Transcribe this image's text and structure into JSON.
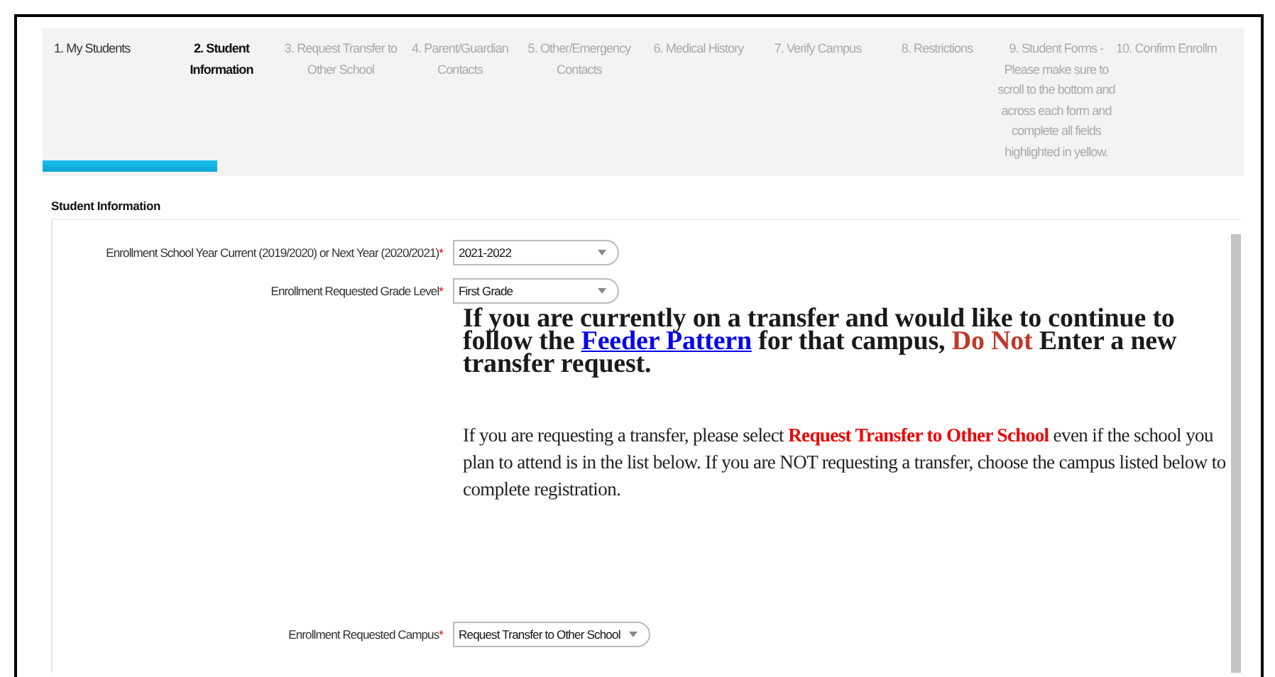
{
  "steps": [
    {
      "label": "1. My Students",
      "selected": false,
      "disabled": false
    },
    {
      "label": "2. Student Information",
      "selected": true,
      "disabled": false
    },
    {
      "label": "3. Request Transfer to Other School",
      "selected": false,
      "disabled": true
    },
    {
      "label": "4. Parent/Guardian Contacts",
      "selected": false,
      "disabled": true
    },
    {
      "label": "5. Other/Emergency Contacts",
      "selected": false,
      "disabled": true
    },
    {
      "label": "6. Medical History",
      "selected": false,
      "disabled": true
    },
    {
      "label": "7. Verify Campus",
      "selected": false,
      "disabled": true
    },
    {
      "label": "8. Restrictions",
      "selected": false,
      "disabled": true
    },
    {
      "label": "9. Student Forms - Please make sure to scroll to the bottom and across each form and complete all fields highlighted in yellow.",
      "selected": false,
      "disabled": true
    },
    {
      "label": "10. Confirm Enrollm",
      "selected": false,
      "disabled": true
    }
  ],
  "progress": {
    "level": 0.145
  },
  "section_title": "Student Information",
  "fields": [
    {
      "label": "Enrollment School Year Current (2019/2020) or Next Year (2020/2021)",
      "required_mark": "*",
      "value": "2021-2022"
    },
    {
      "label": "Enrollment Requested Grade Level",
      "required_mark": "*",
      "value": "First Grade"
    }
  ],
  "notice": [
    {
      "kind": "plain",
      "text": "If you are currently on a transfer and would like to continue to follow the "
    },
    {
      "kind": "link",
      "text": "Feeder Pattern"
    },
    {
      "kind": "plain",
      "text": " for that campus, "
    },
    {
      "kind": "warning",
      "text": "Do Not"
    },
    {
      "kind": "plain",
      "text": " Enter a new transfer request."
    }
  ],
  "instructions": [
    {
      "kind": "plain",
      "text": "If you are requesting a transfer, please select "
    },
    {
      "kind": "warning",
      "text": "Request Transfer to Other School"
    },
    {
      "kind": "plain",
      "text": " even if the school you plan to attend is in the list below. If you are NOT requesting a transfer, choose the campus listed below to complete registration."
    }
  ],
  "campus_field": {
    "label": "Enrollment Requested Campus",
    "required_mark": "*",
    "value": "Request Transfer to Other School"
  }
}
